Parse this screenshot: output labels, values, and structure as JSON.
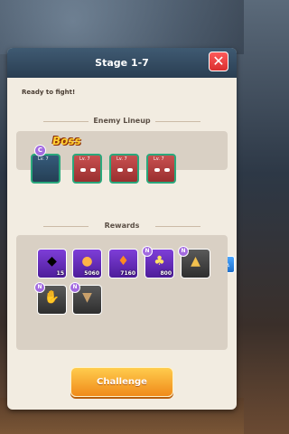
{
  "modal": {
    "title": "Stage 1-7",
    "close_icon": "✕"
  },
  "status": "Ready to fight!",
  "enemy_lineup": {
    "title": "Enemy Lineup",
    "boss_label": "Boss",
    "boss_class_badge": "C",
    "enemies": [
      {
        "level": "Lv. 7",
        "type": "boss"
      },
      {
        "level": "Lv. 7",
        "type": "minion"
      },
      {
        "level": "Lv. 7",
        "type": "minion"
      },
      {
        "level": "Lv. 7",
        "type": "minion"
      }
    ]
  },
  "rewards": {
    "title": "Rewards",
    "items": [
      {
        "name": "purple-crystal",
        "qty": "15"
      },
      {
        "name": "gold-coin",
        "qty": "5060"
      },
      {
        "name": "orange-flame",
        "qty": "7160"
      },
      {
        "name": "potion-flask",
        "qty": "800"
      },
      {
        "name": "gold-map",
        "qty": ""
      },
      {
        "name": "gold-gauntlet",
        "qty": ""
      },
      {
        "name": "leather-boot",
        "qty": ""
      }
    ],
    "corner_badge": "N"
  },
  "challenge_label": "Challenge",
  "colors": {
    "accent": "#f08a1a",
    "header": "#2a3e52",
    "enemy_border": "#2aa87c"
  }
}
